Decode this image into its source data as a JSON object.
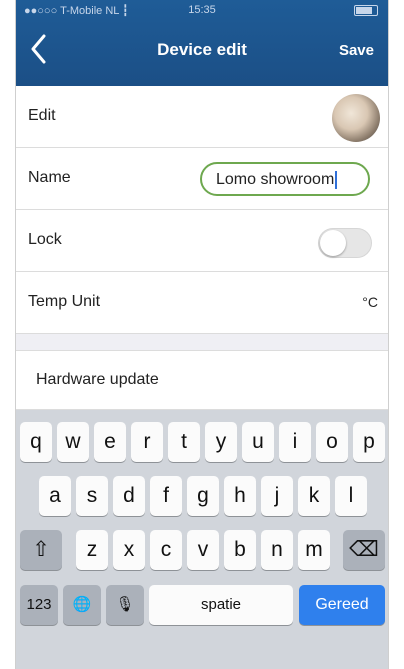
{
  "status_bar": {
    "carrier": "●●○○○ T-Mobile NL ┇",
    "time": "15:35"
  },
  "nav": {
    "back_icon": "chevron-left",
    "title": "Device edit",
    "save_label": "Save"
  },
  "rows": {
    "edit": {
      "label": "Edit"
    },
    "name": {
      "label": "Name",
      "value": "Lomo  showroom"
    },
    "lock": {
      "label": "Lock",
      "toggle_state": "off"
    },
    "temp_unit": {
      "label": "Temp Unit",
      "value": "°C"
    },
    "hardware_update": {
      "label": "Hardware update"
    }
  },
  "keyboard": {
    "row1": [
      "q",
      "w",
      "e",
      "r",
      "t",
      "y",
      "u",
      "i",
      "o",
      "p"
    ],
    "row2": [
      "a",
      "s",
      "d",
      "f",
      "g",
      "h",
      "j",
      "k",
      "l"
    ],
    "row3": [
      "z",
      "x",
      "c",
      "v",
      "b",
      "n",
      "m"
    ],
    "shift_icon": "⇧",
    "backspace_icon": "⌫",
    "numbers_label": "123",
    "globe_icon": "🌐",
    "mic_icon": "🎙",
    "space_label": "spatie",
    "return_label": "Gereed"
  },
  "colors": {
    "header": "#1d5690",
    "accent_blue": "#2f80ed",
    "highlight_green": "#6ea84f"
  }
}
